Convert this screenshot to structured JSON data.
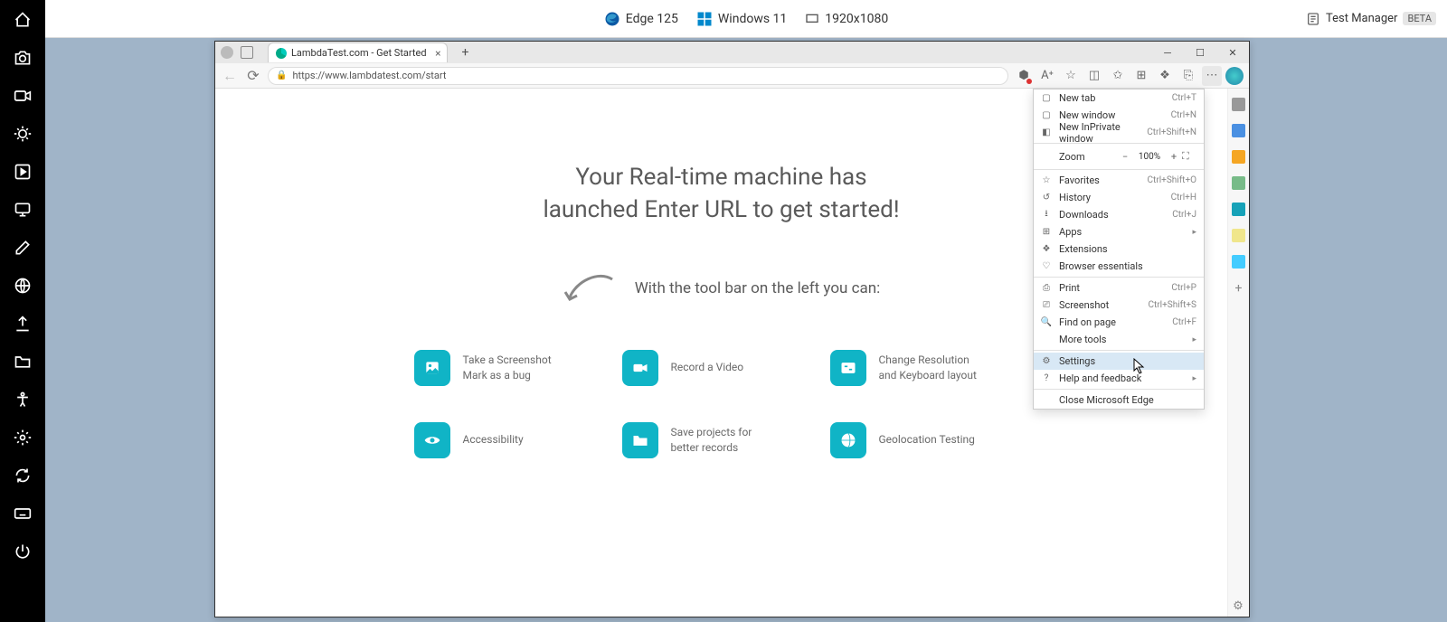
{
  "top": {
    "browser_name": "Edge 125",
    "os_name": "Windows 11",
    "resolution": "1920x1080",
    "test_manager": "Test Manager",
    "beta": "BETA"
  },
  "left_toolbar": [
    "home-icon",
    "camera-icon",
    "video-icon",
    "bug-icon",
    "play-icon",
    "screen-icon",
    "edit-icon",
    "globe-icon",
    "upload-icon",
    "folder-icon",
    "accessibility-icon",
    "gear-icon",
    "sync-icon",
    "keyboard-icon",
    "power-icon"
  ],
  "tab": {
    "title": "LambdaTest.com - Get Started"
  },
  "url": "https://www.lambdatest.com/start",
  "page": {
    "headline_l1": "Your Real-time machine has",
    "headline_l2": "launched Enter URL to get started!",
    "subline": "With the tool bar on the left you can:",
    "features": [
      {
        "t1": "Take a Screenshot",
        "t2": "Mark as a bug"
      },
      {
        "t1": "Record a Video",
        "t2": ""
      },
      {
        "t1": "Change Resolution",
        "t2": "and Keyboard layout"
      },
      {
        "t1": "Accessibility",
        "t2": ""
      },
      {
        "t1": "Save projects for",
        "t2": "better records"
      },
      {
        "t1": "Geolocation Testing",
        "t2": ""
      }
    ]
  },
  "edge_menu": {
    "new_tab": "New tab",
    "new_tab_s": "Ctrl+T",
    "new_window": "New window",
    "new_window_s": "Ctrl+N",
    "new_inprivate": "New InPrivate window",
    "new_inprivate_s": "Ctrl+Shift+N",
    "zoom": "Zoom",
    "zoom_val": "100%",
    "favorites": "Favorites",
    "favorites_s": "Ctrl+Shift+O",
    "history": "History",
    "history_s": "Ctrl+H",
    "downloads": "Downloads",
    "downloads_s": "Ctrl+J",
    "apps": "Apps",
    "extensions": "Extensions",
    "essentials": "Browser essentials",
    "print": "Print",
    "print_s": "Ctrl+P",
    "screenshot": "Screenshot",
    "screenshot_s": "Ctrl+Shift+S",
    "find": "Find on page",
    "find_s": "Ctrl+F",
    "more_tools": "More tools",
    "settings": "Settings",
    "help": "Help and feedback",
    "close_edge": "Close Microsoft Edge"
  }
}
